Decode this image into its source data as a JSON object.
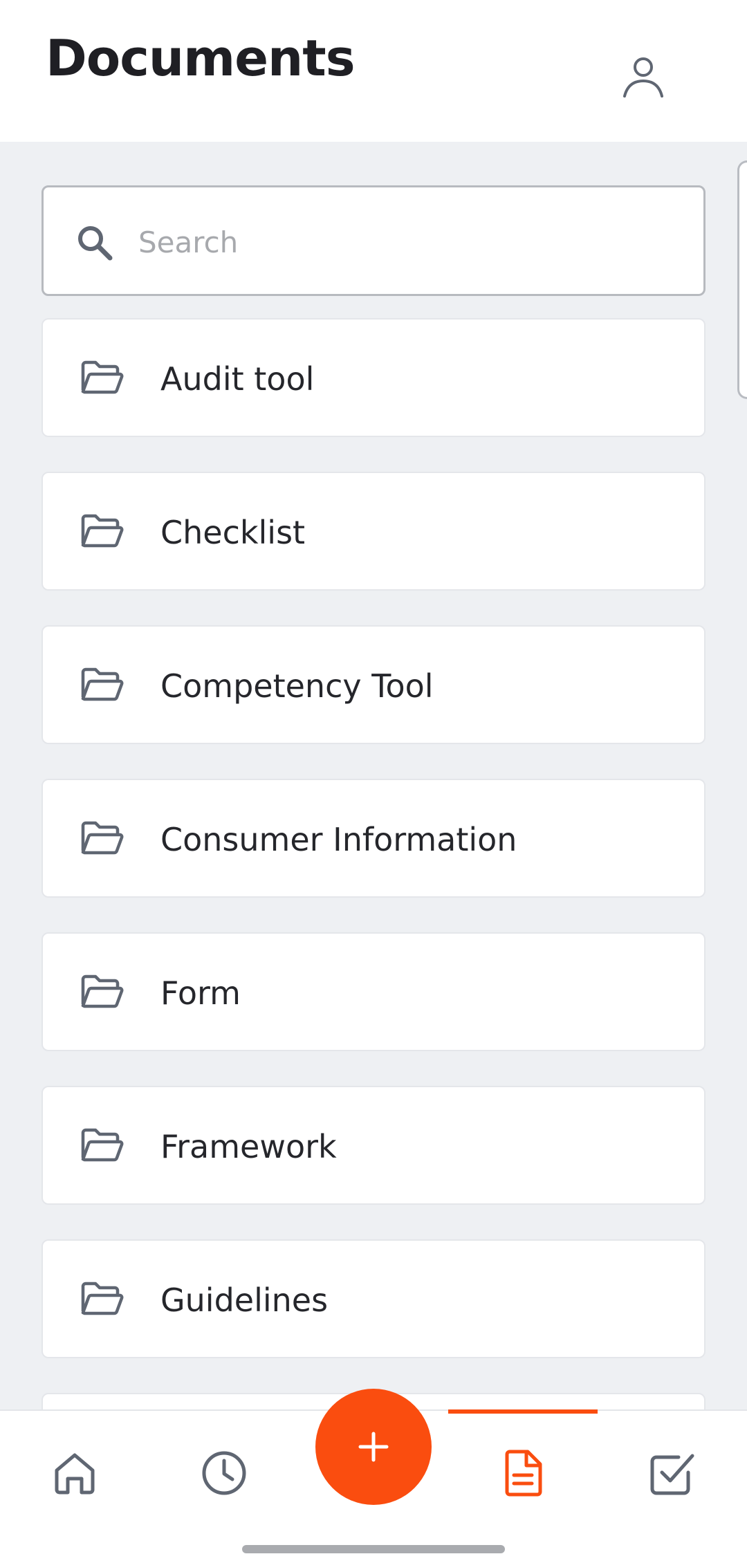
{
  "header": {
    "title": "Documents"
  },
  "search": {
    "placeholder": "Search",
    "value": ""
  },
  "folders": [
    {
      "label": "Audit tool"
    },
    {
      "label": "Checklist"
    },
    {
      "label": "Competency Tool"
    },
    {
      "label": "Consumer Information"
    },
    {
      "label": "Form"
    },
    {
      "label": "Framework"
    },
    {
      "label": "Guidelines"
    },
    {
      "label": ""
    }
  ],
  "nav": {
    "items": [
      "home-icon",
      "history-icon",
      "documents-icon",
      "tasks-icon"
    ],
    "active": "documents",
    "fab_icon": "plus-icon"
  },
  "colors": {
    "accent": "#fa4d0f",
    "background": "#eef0f3",
    "icon": "#5f6672",
    "text": "#1f1f24"
  }
}
